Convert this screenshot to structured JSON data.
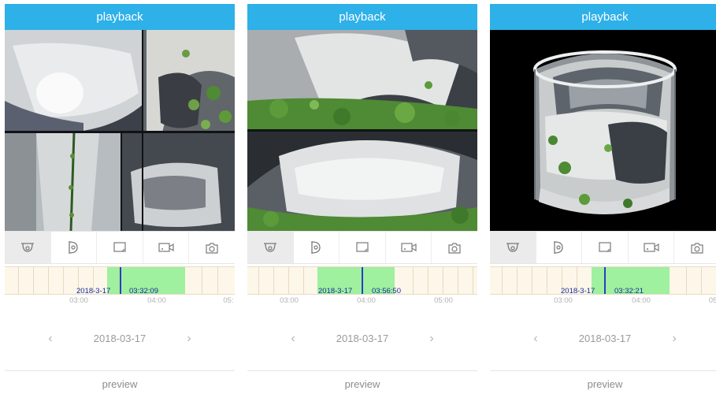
{
  "colors": {
    "header": "#2eb0e8",
    "record": "#9ff09f",
    "cursor": "#2c3cc6",
    "track": "#fdf7e9"
  },
  "icons": [
    "fisheye-icon",
    "wall-mount-icon",
    "single-view-icon",
    "record-icon",
    "snapshot-icon"
  ],
  "screens": [
    {
      "title": "playback",
      "view": "quad",
      "toolbar": {
        "active_index": 0
      },
      "timeline": {
        "cursor_date": "2018-3-17",
        "cursor_time": "03:32:09",
        "hour_labels": [
          "03:00",
          "04:00",
          "05:"
        ]
      },
      "date": "2018-03-17",
      "prev_label": "‹",
      "next_label": "›",
      "preview_label": "preview"
    },
    {
      "title": "playback",
      "view": "dual",
      "toolbar": {
        "active_index": 0
      },
      "timeline": {
        "cursor_date": "2018-3-17",
        "cursor_time": "03:56:50",
        "hour_labels": [
          "03:00",
          "04:00",
          "05:00"
        ]
      },
      "date": "2018-03-17",
      "prev_label": "‹",
      "next_label": "›",
      "preview_label": "preview"
    },
    {
      "title": "playback",
      "view": "cylinder",
      "toolbar": {
        "active_index": 0
      },
      "timeline": {
        "cursor_date": "2018-3-17",
        "cursor_time": "03:32:21",
        "hour_labels": [
          "03:00",
          "04:00",
          "05"
        ]
      },
      "date": "2018-03-17",
      "prev_label": "‹",
      "next_label": "›",
      "preview_label": "preview"
    }
  ]
}
